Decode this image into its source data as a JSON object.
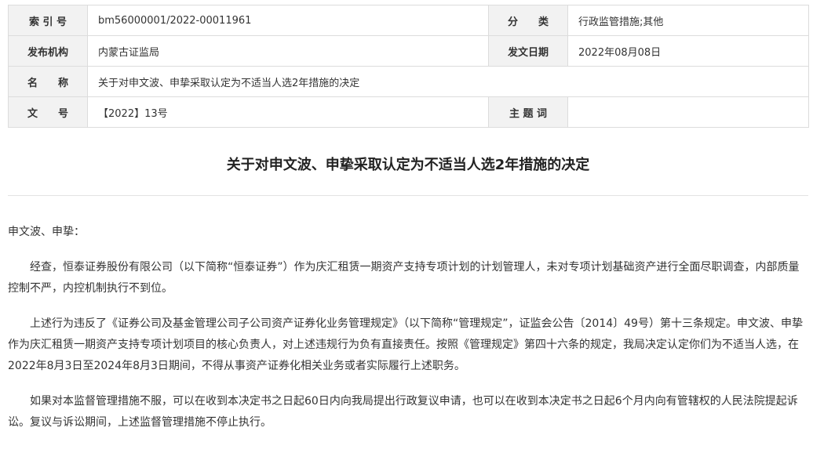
{
  "meta": {
    "index_label": "索 引 号",
    "index_value": "bm56000001/2022-00011961",
    "category_label": "分　　类",
    "category_value": "行政监管措施;其他",
    "issuer_label": "发布机构",
    "issuer_value": "内蒙古证监局",
    "date_label": "发文日期",
    "date_value": "2022年08月08日",
    "name_label": "名　　称",
    "name_value": "关于对申文波、申挚采取认定为不适当人选2年措施的决定",
    "docno_label": "文　　号",
    "docno_value": "【2022】13号",
    "keywords_label": "主 题 词",
    "keywords_value": ""
  },
  "document": {
    "title": "关于对申文波、申挚采取认定为不适当人选2年措施的决定",
    "addressee": "申文波、申挚：",
    "paragraphs": [
      "经查，恒泰证券股份有限公司（以下简称“恒泰证券”）作为庆汇租赁一期资产支持专项计划的计划管理人，未对专项计划基础资产进行全面尽职调查，内部质量控制不严，内控机制执行不到位。",
      "上述行为违反了《证券公司及基金管理公司子公司资产证券化业务管理规定》（以下简称“管理规定”，证监会公告〔2014〕49号）第十三条规定。申文波、申挚作为庆汇租赁一期资产支持专项计划项目的核心负责人，对上述违规行为负有直接责任。按照《管理规定》第四十六条的规定，我局决定认定你们为不适当人选，在2022年8月3日至2024年8月3日期间，不得从事资产证券化相关业务或者实际履行上述职务。",
      "如果对本监督管理措施不服，可以在收到本决定书之日起60日内向我局提出行政复议申请，也可以在收到本决定书之日起6个月内向有管辖权的人民法院提起诉讼。复议与诉讼期间，上述监督管理措施不停止执行。"
    ]
  }
}
